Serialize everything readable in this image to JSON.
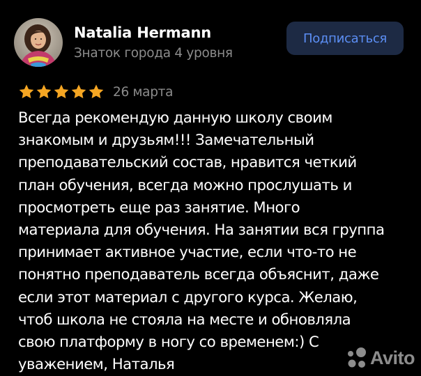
{
  "review": {
    "author": {
      "name": "Natalia Hermann",
      "level": "Знаток города 4 уровня"
    },
    "subscribe_label": "Подписаться",
    "rating": 5,
    "date": "26 марта",
    "text_lines": [
      "Всегда рекомендую данную школу своим",
      "знакомым и друзьям!!! Замечательный",
      "преподавательский состав, нравится четкий",
      "план обучения, всегда можно прослушать и",
      "просмотреть еще раз занятие. Много",
      "материала для обучения. На занятии вся группа",
      "принимает активное участие, если что-то не",
      "понятно преподаватель всегда объяснит, даже",
      "если этот материал с другого курса. Желаю,",
      "чтоб школа не стояла на месте и обновляла",
      "свою платформу в ногу со временем:) С",
      "уважением, Наталья"
    ]
  },
  "watermark": {
    "brand": "Avito"
  },
  "colors": {
    "background": "#000000",
    "star": "#f5a623",
    "muted_text": "#8c8c8c",
    "button_bg": "#1d2a44",
    "button_text": "#5c8ff5"
  },
  "icons": {
    "avatar": "user-photo",
    "star": "star-icon",
    "watermark": "avito-logo-icon"
  }
}
